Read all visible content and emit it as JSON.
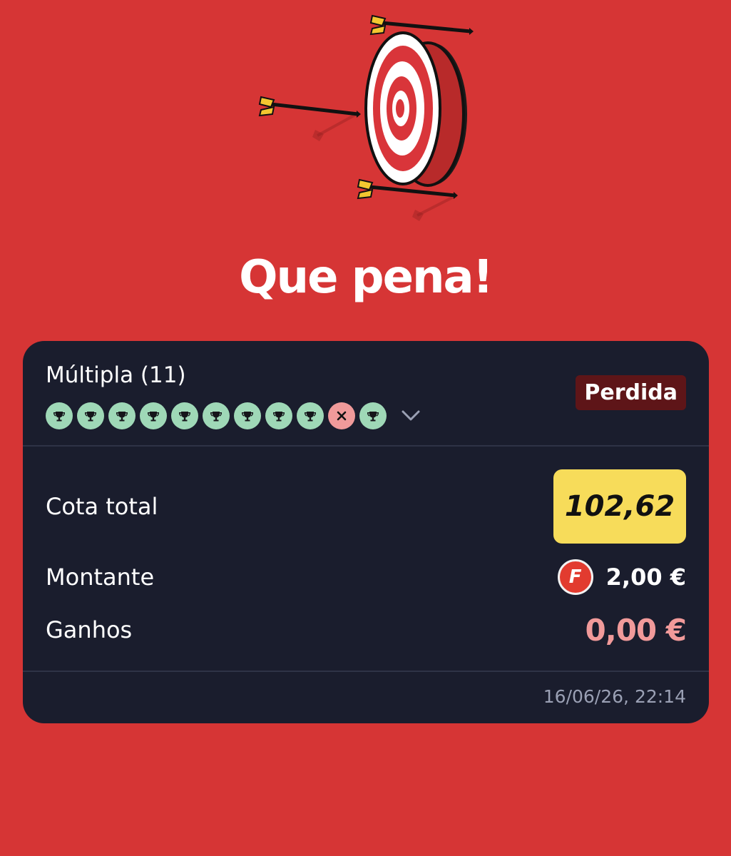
{
  "illustration": {
    "icon": "target-with-arrows-icon"
  },
  "headline": "Que pena!",
  "bet": {
    "type_label": "Múltipla (11)",
    "status": "Perdida",
    "legs": [
      "won",
      "won",
      "won",
      "won",
      "won",
      "won",
      "won",
      "won",
      "won",
      "lost",
      "won"
    ],
    "expand_icon": "chevron-down-icon",
    "total_odds_label": "Cota total",
    "total_odds_value": "102,62",
    "stake_label": "Montante",
    "stake_value": "2,00 €",
    "stake_badge": "F",
    "winnings_label": "Ganhos",
    "winnings_value": "0,00 €",
    "timestamp": "16/06/26, 22:14"
  },
  "colors": {
    "background": "#d63535",
    "card": "#1a1d2d",
    "status_badge": "#5e1518",
    "odds_box": "#f7dc5a",
    "leg_won": "#9fd8b7",
    "leg_lost": "#f09a9a",
    "winnings": "#f19a9a"
  }
}
